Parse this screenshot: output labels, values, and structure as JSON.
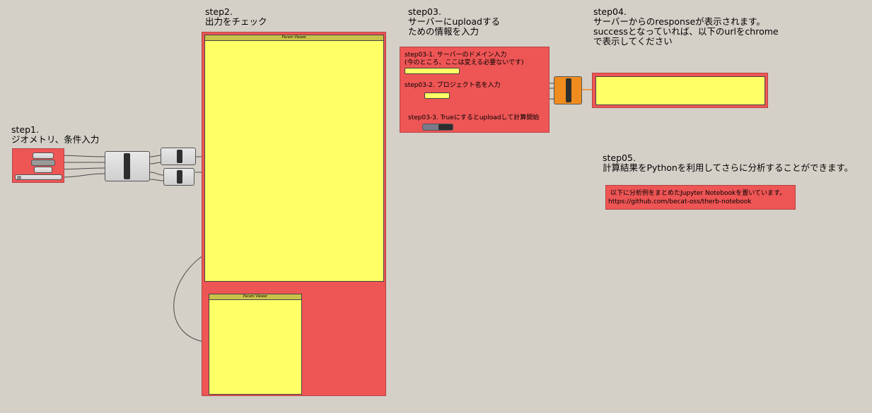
{
  "steps": {
    "step1": "step1.\nジオメトリ、条件入力",
    "step2": "step2.\n出力をチェック",
    "step03": "step03.\nサーバーにuploadする\nための情報を入力",
    "step04": "step04.\nサーバーからのresponseが表示されます。\nsuccessとなっていれば、以下のurlをchrome\nで表示してください",
    "step05": "step05.\n計算結果をPythonを利用してさらに分析することができます。"
  },
  "step03_fields": {
    "domain_label": "step03-1. サーバーのドメイン入力\n(今のところ、ここは変える必要ないです)",
    "project_label": "step03-2. プロジェクト名を入力",
    "toggle_label": "step03-3. Trueにするとuploadして計算開始"
  },
  "panels": {
    "main_panel_title": "Param Viewer",
    "sub_panel_title": "Param Viewer"
  },
  "note": {
    "line1": "以下に分析例をまとめたJupyter Notebookを置いています。",
    "line2": "https://github.com/becat-oss/therb-notebook"
  },
  "colors": {
    "group_red": "#ee5555",
    "panel_yellow": "#ffff66",
    "upload_orange": "#f08c1e",
    "canvas": "#d4d0c8"
  }
}
